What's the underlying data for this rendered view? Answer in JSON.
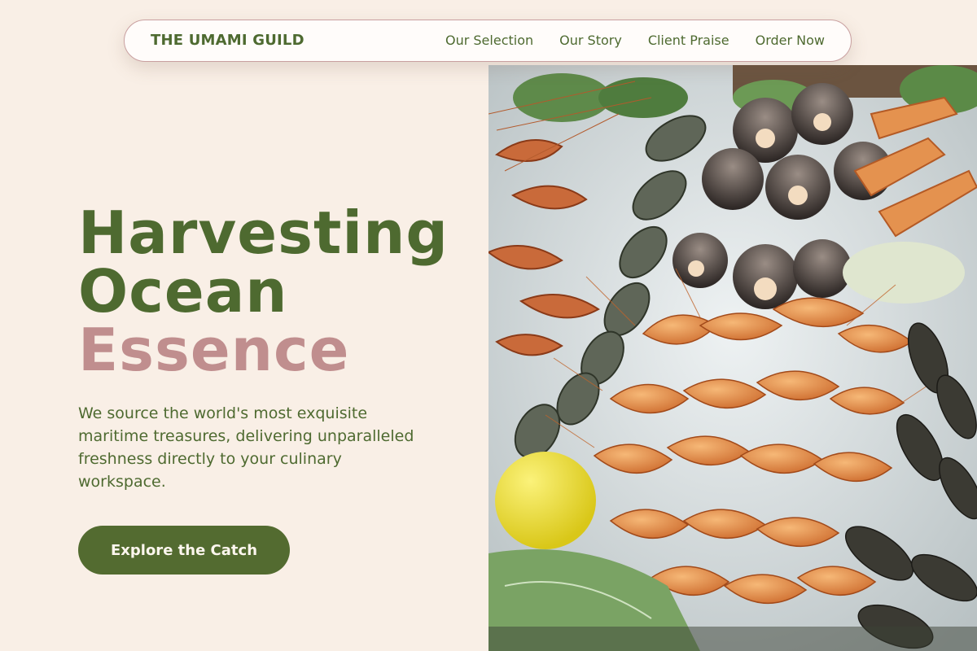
{
  "nav": {
    "brand": "THE UMAMI GUILD",
    "links": [
      "Our Selection",
      "Our Story",
      "Client Praise",
      "Order Now"
    ]
  },
  "hero": {
    "title_line1": "Harvesting",
    "title_line2": "Ocean",
    "title_line3": "Essence",
    "description": "We source the world's most exquisite maritime treasures, delivering unparalleled freshness directly to your culinary workspace.",
    "cta_label": "Explore the Catch"
  },
  "colors": {
    "background": "#f9efe6",
    "primary_green": "#4e6a30",
    "accent_rose": "#c08e8e",
    "button": "#536b30"
  },
  "image": {
    "subject": "seafood-platter-photo"
  }
}
